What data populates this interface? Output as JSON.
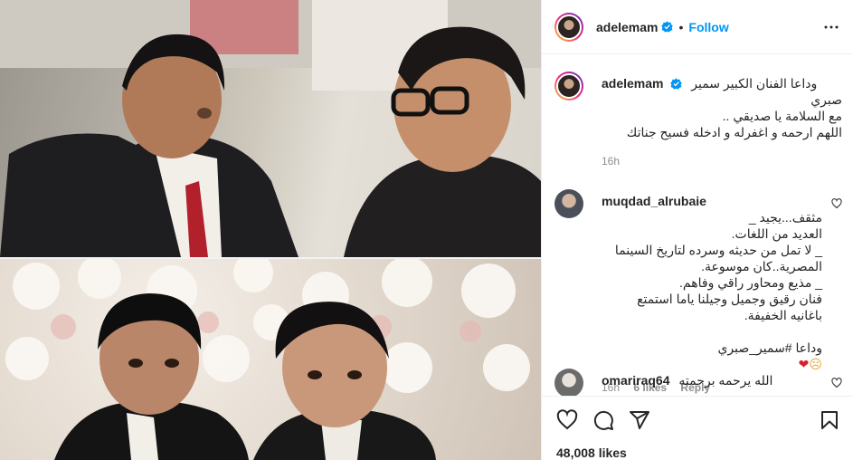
{
  "post": {
    "username": "adelemam",
    "follow_label": "Follow",
    "dot": "•",
    "caption_line_1": "وداعا الفنان الكبير سمير",
    "caption_line_2": "صبري",
    "caption_line_3": "مع السلامة يا صديقي ..",
    "caption_line_4": "اللهم ارحمه و اغفرله و ادخله فسيح جناتك",
    "caption_time": "16h",
    "likes": "48,008 likes"
  },
  "comments": [
    {
      "username": "muqdad_alrubaie",
      "text": "مثقف...يجيد _\nالعديد من اللغات.\n_ لا تمل من حديثه وسرده لتاريخ السينما المصرية..كان موسوعة.\n_ مذيع ومحاور راقي وفاهم.\nفنان رقيق وجميل وجيلنا ياما استمتع باغانيه الخفيفة.",
      "hashtag_line": "وداعا #سمير_صبري",
      "time": "16h",
      "likes": "6 likes",
      "reply": "Reply"
    },
    {
      "username": "omariraq64",
      "text": "الله يرحمه برحمته"
    }
  ],
  "colors": {
    "link": "#0095f6",
    "text": "#262626",
    "muted": "#8e8e8e",
    "hashtag": "#00376b",
    "border": "#efefef"
  },
  "icons": {
    "verified": "verified-badge-icon",
    "more": "more-options-icon",
    "like": "heart-icon",
    "comment": "comment-icon",
    "share": "share-icon",
    "save": "bookmark-icon"
  }
}
